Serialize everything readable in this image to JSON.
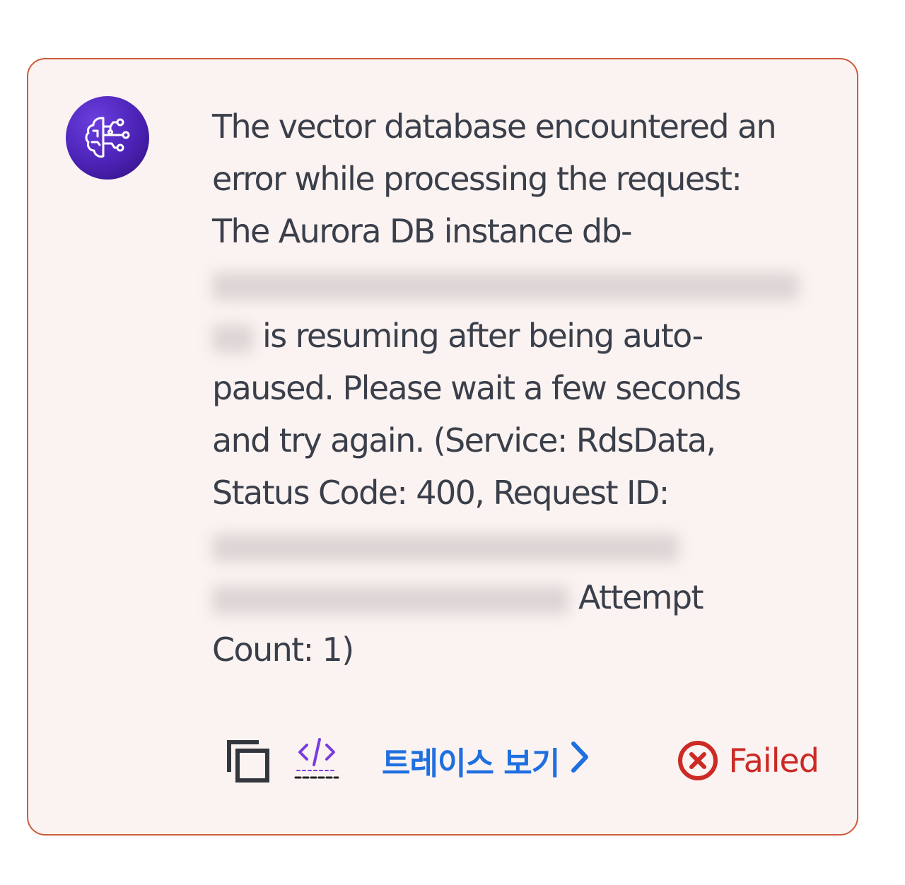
{
  "message": {
    "line1": "The vector database encountered an",
    "line2": "error while processing the request:",
    "line3": "The Aurora DB instance db-",
    "line5": "is resuming after being auto-",
    "line6": "paused. Please wait a few seconds",
    "line7": "and try again. (Service: RdsData,",
    "line8": "Status Code: 400, Request ID:",
    "line10": "Attempt",
    "line11": "Count: 1)"
  },
  "footer": {
    "trace_label": "트레이스 보기",
    "status_label": "Failed"
  },
  "icons": {
    "avatar": "brain-circuit-icon",
    "copy": "copy-icon",
    "code": "code-icon",
    "trace": "chevron-right-icon",
    "status": "error-circle-icon"
  },
  "colors": {
    "card_border": "#cf5a3a",
    "card_background": "#faf3f1",
    "link": "#1f6fe0",
    "error": "#cc2a25",
    "avatar": "#4b22b5",
    "code_icon": "#7a3ce0"
  }
}
